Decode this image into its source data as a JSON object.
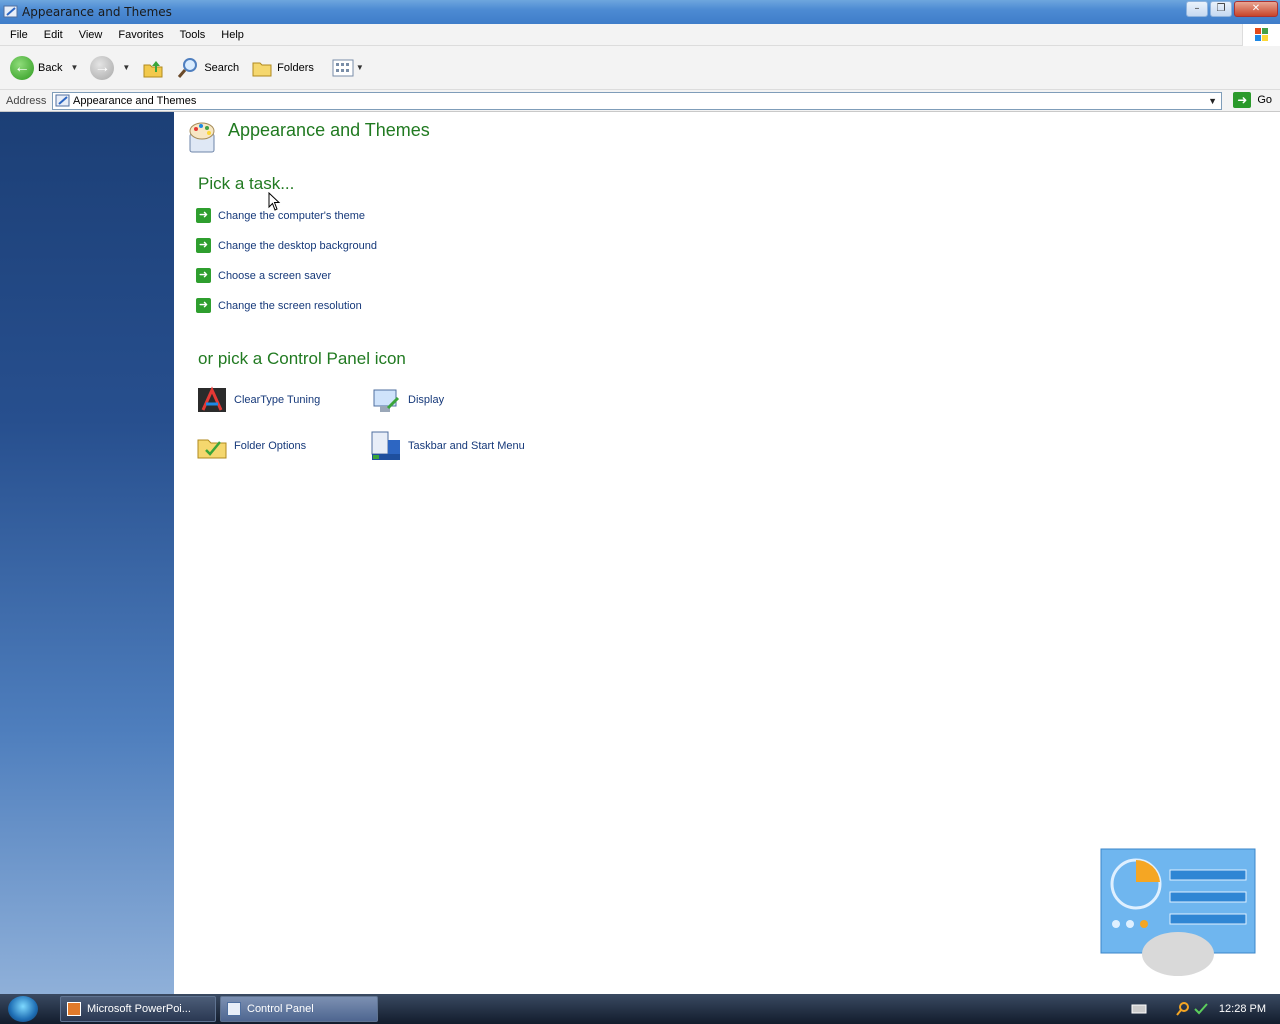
{
  "window": {
    "title": "Appearance and Themes"
  },
  "menu": [
    "File",
    "Edit",
    "View",
    "Favorites",
    "Tools",
    "Help"
  ],
  "toolbar": {
    "back": "Back",
    "search": "Search",
    "folders": "Folders"
  },
  "address": {
    "label": "Address",
    "value": "Appearance and Themes",
    "go": "Go"
  },
  "content": {
    "title": "Appearance and Themes",
    "pick_task": "Pick a task...",
    "tasks": [
      "Change the computer's theme",
      "Change the desktop background",
      "Choose a screen saver",
      "Change the screen resolution"
    ],
    "pick_icon": "or pick a Control Panel icon",
    "icons": [
      "ClearType Tuning",
      "Display",
      "Folder Options",
      "Taskbar and Start Menu"
    ]
  },
  "taskbar": {
    "buttons": [
      "Microsoft PowerPoi...",
      "Control Panel"
    ],
    "clock": "12:28 PM"
  },
  "colors": {
    "accent_green": "#217a21",
    "link_blue": "#16397a",
    "sidebar_blue": "#274f8e"
  }
}
